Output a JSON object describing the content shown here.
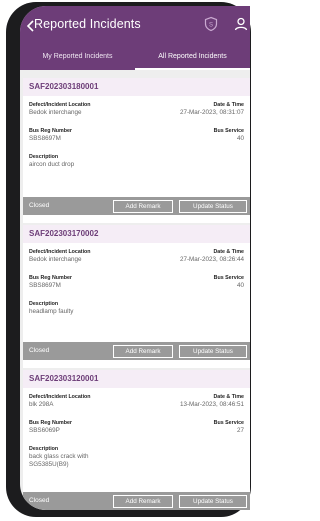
{
  "header": {
    "title": "Reported Incidents",
    "icons": [
      "back-chevron-icon",
      "shield-icon",
      "user-icon"
    ],
    "tabs": [
      {
        "label": "My Reported Incidents",
        "active": false
      },
      {
        "label": "All Reported Incidents",
        "active": true
      }
    ]
  },
  "labels": {
    "location": "Defect/Incident Location",
    "datetime": "Date & Time",
    "bus_reg": "Bus Reg Number",
    "bus_service": "Bus Service",
    "description": "Description",
    "add_remark": "Add Remark",
    "update_status": "Update Status"
  },
  "incidents": [
    {
      "id": "SAF202303180001",
      "location": "Bedok interchange",
      "datetime": "27-Mar-2023, 08:31:07",
      "bus_reg": "SBS8697M",
      "bus_service": "40",
      "description": "aircon duct drop",
      "status": "Closed"
    },
    {
      "id": "SAF202303170002",
      "location": "Bedok interchange",
      "datetime": "27-Mar-2023, 08:26:44",
      "bus_reg": "SBS8697M",
      "bus_service": "40",
      "description": "headlamp faulty",
      "status": "Closed"
    },
    {
      "id": "SAF202303120001",
      "location": "blk 298A",
      "datetime": "13-Mar-2023, 08:46:51",
      "bus_reg": "SBS6069P",
      "bus_service": "27",
      "description": "back glass crack with",
      "description_line2": "SG5385U(B9)",
      "status": "Closed"
    }
  ],
  "colors": {
    "primary": "#6d3d78",
    "id_bar": "#f5edf6",
    "footer": "#9a9a9a",
    "background": "#eeeeee"
  }
}
